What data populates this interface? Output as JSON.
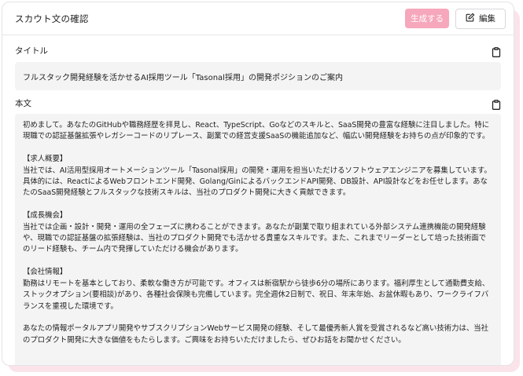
{
  "header": {
    "title": "スカウト文の確認",
    "generate_label": "生成する",
    "edit_label": "編集"
  },
  "title_section": {
    "label": "タイトル",
    "value": "フルスタック開発経験を活かせるAI採用ツール「Tasonal採用」の開発ポジションのご案内"
  },
  "body_section": {
    "label": "本文",
    "value": "初めまして。あなたのGitHubや職務経歴を拝見し、React、TypeScript、Goなどのスキルと、SaaS開発の豊富な経験に注目しました。特に現職での認証基盤拡張やレガシーコードのリプレース、副業での経営支援SaaSの機能追加など、幅広い開発経験をお持ちの点が印象的です。\n\n【求人概要】\n当社では、AI活用型採用オートメーションツール「Tasonal採用」の開発・運用を担当いただけるソフトウェアエンジニアを募集しています。具体的には、ReactによるWebフロントエンド開発、Golang/GinによるバックエンドAPI開発、DB設計、API設計などをお任せします。あなたのSaaS開発経験とフルスタックな技術スキルは、当社のプロダクト開発に大きく貢献できます。\n\n【成長機会】\n当社では企画・設計・開発・運用の全フェーズに携わることができます。あなたが副業で取り組まれている外部システム連携機能の開発経験や、現職での認証基盤の拡張経験は、当社のプロダクト開発でも活かせる貴重なスキルです。また、これまでリーダーとして培った技術面でのリード経験も、チーム内で発揮していただける機会があります。\n\n【会社情報】\n勤務はリモートを基本としており、柔軟な働き方が可能です。オフィスは新宿駅から徒歩6分の場所にあります。福利厚生として通勤費支給、ストックオプション(要相談)があり、各種社会保険も完備しています。完全週休2日制で、祝日、年末年始、お盆休暇もあり、ワークライフバランスを重視した環境です。\n\nあなたの情報ポータルアプリ開発やサブスクリプションWebサービス開発の経験、そして最優秀新人賞を受賞されるなど高い技術力は、当社のプロダクト開発に大きな価値をもたらします。ご興味をお持ちいただけましたら、ぜひお話をお聞かせください。"
  },
  "icons": {
    "edit": "pencil-square-icon",
    "copy": "clipboard-icon"
  },
  "colors": {
    "accent": "#f6a7bb",
    "field_bg": "#f4f4f5",
    "shadow": "#fbe3ea"
  }
}
